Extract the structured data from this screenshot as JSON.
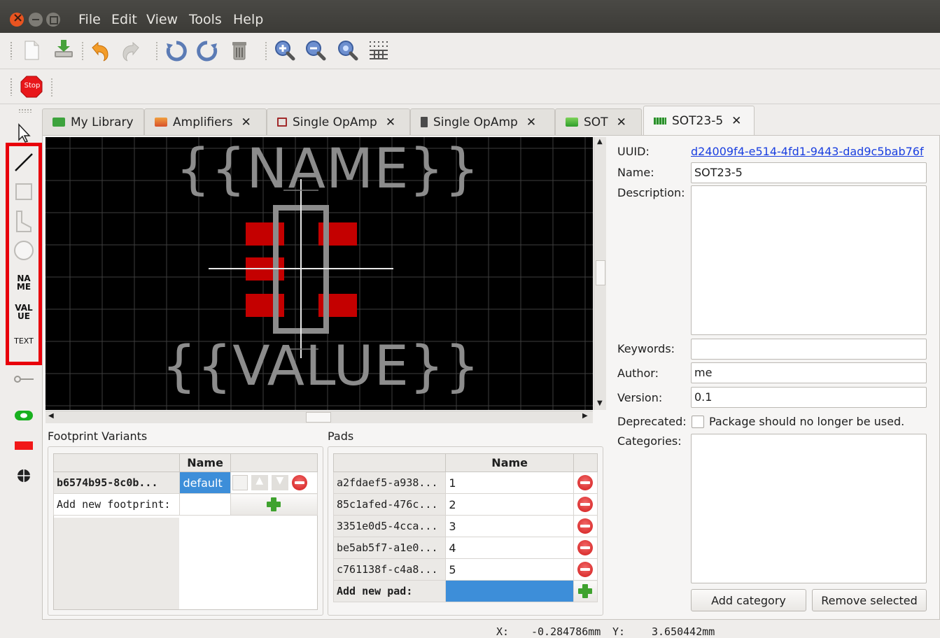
{
  "menu": [
    "File",
    "Edit",
    "View",
    "Tools",
    "Help"
  ],
  "toolbar": {
    "items": [
      "new-library-element-icon",
      "save-icon",
      "undo-icon",
      "redo-icon",
      "rotate-ccw-icon",
      "rotate-cw-icon",
      "remove-icon",
      "zoom-in-icon",
      "zoom-out-icon",
      "zoom-fit-icon",
      "grid-icon"
    ],
    "stop_label": "Stop"
  },
  "left_tools": {
    "name_tool": "NA\nME",
    "value_tool": "VAL\nUE",
    "text_tool": "TEXT"
  },
  "tabs": [
    {
      "label": "My Library",
      "icon": "library-icon",
      "closable": false
    },
    {
      "label": "Amplifiers",
      "icon": "category-folder-icon",
      "closable": true
    },
    {
      "label": "Single OpAmp",
      "icon": "symbol-icon",
      "closable": true
    },
    {
      "label": "Single OpAmp",
      "icon": "component-icon",
      "closable": true
    },
    {
      "label": "SOT",
      "icon": "category-folder-icon",
      "closable": true
    },
    {
      "label": "SOT23-5",
      "icon": "package-icon",
      "closable": true,
      "active": true
    }
  ],
  "canvas": {
    "name_placeholder": "{{NAME}}",
    "value_placeholder": "{{VALUE}}",
    "colors": {
      "background": "#000000",
      "pad": "#c20000",
      "outline": "#8a8a8a",
      "grid": "#4a4a4a"
    }
  },
  "footprint_variants": {
    "title": "Footprint Variants",
    "header_name": "Name",
    "rows": [
      {
        "uuid": "b6574b95-8c0b...",
        "name": "default"
      }
    ],
    "add_label": "Add new footprint:"
  },
  "pads": {
    "title": "Pads",
    "header_name": "Name",
    "rows": [
      {
        "uuid": "a2fdaef5-a938...",
        "name": "1"
      },
      {
        "uuid": "85c1afed-476c...",
        "name": "2"
      },
      {
        "uuid": "3351e0d5-4cca...",
        "name": "3"
      },
      {
        "uuid": "be5ab5f7-a1e0...",
        "name": "4"
      },
      {
        "uuid": "c761138f-c4a8...",
        "name": "5"
      }
    ],
    "add_label": "Add new pad:"
  },
  "properties": {
    "uuid_label": "UUID:",
    "uuid_value": "d24009f4-e514-4fd1-9443-dad9c5bab76f",
    "name_label": "Name:",
    "name_value": "SOT23-5",
    "description_label": "Description:",
    "description_value": "",
    "keywords_label": "Keywords:",
    "keywords_value": "",
    "author_label": "Author:",
    "author_value": "me",
    "version_label": "Version:",
    "version_value": "0.1",
    "deprecated_label": "Deprecated:",
    "deprecated_text": "Package should no longer be used.",
    "deprecated_checked": false,
    "categories_label": "Categories:",
    "add_category": "Add category",
    "remove_selected": "Remove selected"
  },
  "status": {
    "x_label": "X:",
    "x_value": "-0.284786mm",
    "y_label": "Y:",
    "y_value": "3.650442mm"
  }
}
